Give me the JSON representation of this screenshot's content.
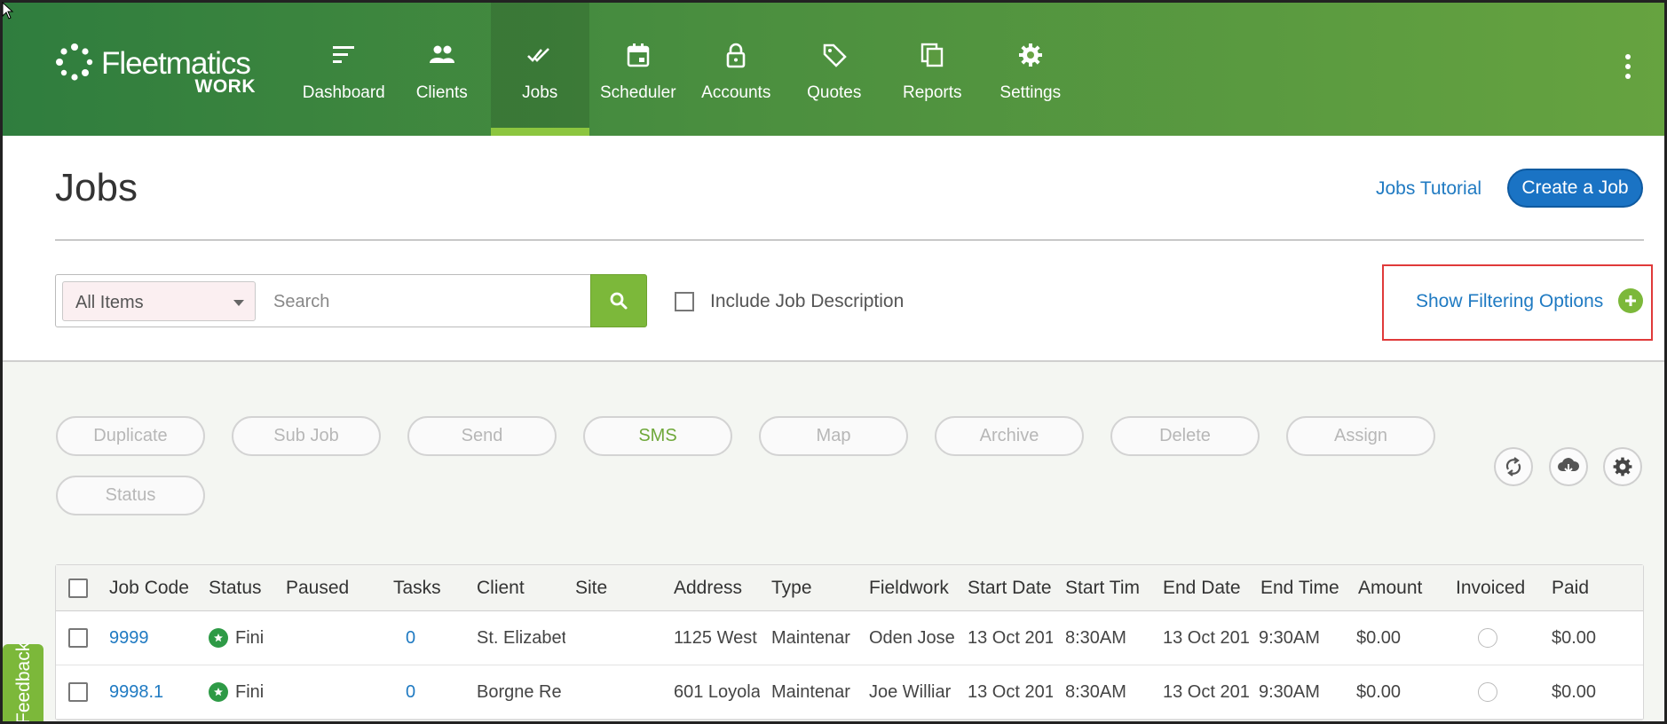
{
  "brand": {
    "name": "Fleetmatics",
    "sub": "WORK"
  },
  "nav": {
    "items": [
      {
        "label": "Dashboard",
        "icon": "dashboard-icon"
      },
      {
        "label": "Clients",
        "icon": "clients-icon"
      },
      {
        "label": "Jobs",
        "icon": "jobs-icon",
        "active": true
      },
      {
        "label": "Scheduler",
        "icon": "calendar-icon"
      },
      {
        "label": "Accounts",
        "icon": "lock-icon"
      },
      {
        "label": "Quotes",
        "icon": "tag-icon"
      },
      {
        "label": "Reports",
        "icon": "copy-icon"
      },
      {
        "label": "Settings",
        "icon": "gear-icon"
      }
    ]
  },
  "page": {
    "title": "Jobs",
    "tutorial_link": "Jobs Tutorial",
    "create_button": "Create a Job"
  },
  "search": {
    "filter_select": "All Items",
    "placeholder": "Search",
    "include_description_label": "Include Job Description",
    "show_filtering_label": "Show Filtering Options"
  },
  "actions": {
    "duplicate": "Duplicate",
    "sub_job": "Sub Job",
    "send": "Send",
    "sms": "SMS",
    "map": "Map",
    "archive": "Archive",
    "delete": "Delete",
    "assign": "Assign",
    "status": "Status"
  },
  "table": {
    "headers": {
      "job_code": "Job Code",
      "status": "Status",
      "paused": "Paused",
      "tasks": "Tasks",
      "client": "Client",
      "site": "Site",
      "address": "Address",
      "type": "Type",
      "fieldworker": "Fieldwork",
      "start_date": "Start Date",
      "start_time": "Start Tim",
      "end_date": "End Date",
      "end_time": "End Time",
      "amount": "Amount",
      "invoiced": "Invoiced",
      "paid": "Paid"
    },
    "rows": [
      {
        "job_code": "9999",
        "status": "Fini",
        "tasks": "0",
        "client": "St. Elizabet",
        "address": "1125 West",
        "type": "Maintenar",
        "fieldworker": "Oden Jose",
        "start_date": "13 Oct 201",
        "start_time": "8:30AM",
        "end_date": "13 Oct 201",
        "end_time": "9:30AM",
        "amount": "$0.00",
        "paid": "$0.00"
      },
      {
        "job_code": "9998.1",
        "status": "Fini",
        "tasks": "0",
        "client": "Borgne Re",
        "address": "601 Loyola",
        "type": "Maintenar",
        "fieldworker": "Joe Williar",
        "start_date": "13 Oct 201",
        "start_time": "8:30AM",
        "end_date": "13 Oct 201",
        "end_time": "9:30AM",
        "amount": "$0.00",
        "paid": "$0.00"
      }
    ]
  },
  "feedback_label": "Feedback",
  "colors": {
    "nav_green_dark": "#2f7d3e",
    "nav_green_light": "#66a340",
    "accent_green": "#7cb83a",
    "link_blue": "#1f7ac2",
    "primary_button": "#1a73c4",
    "highlight_red": "#e03a3a"
  }
}
